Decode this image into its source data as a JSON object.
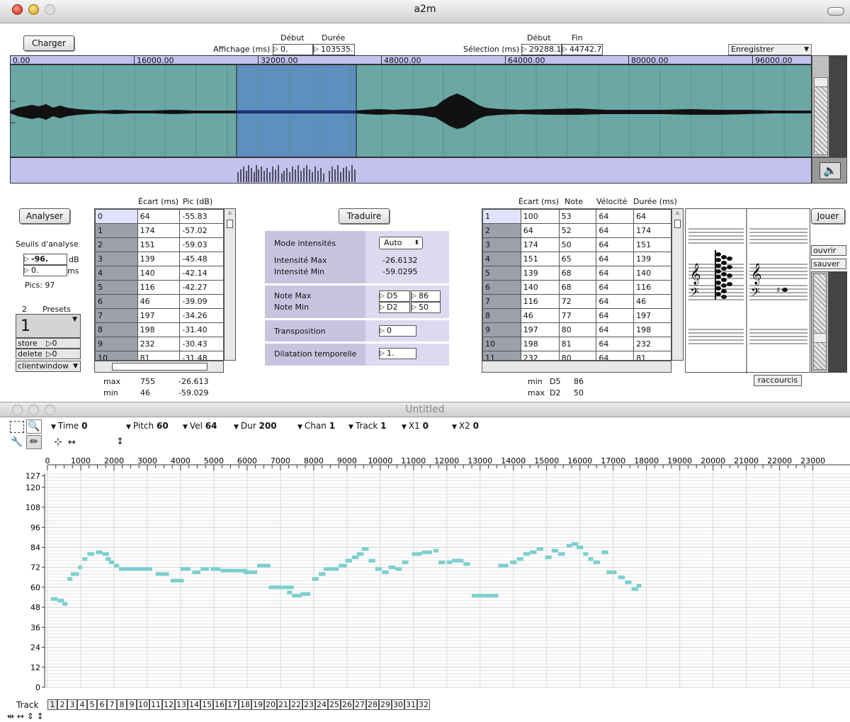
{
  "window_a2m": {
    "title": "a2m",
    "charger": "Charger",
    "affichage_label": "Affichage (ms)",
    "debut_label": "Début",
    "duree_label": "Durée",
    "affichage_debut": "0.",
    "affichage_duree": "103535.",
    "selection_label": "Sélection (ms)",
    "selection_debut_label": "Début",
    "selection_fin_label": "Fin",
    "selection_debut": "29288.1",
    "selection_fin": "44742.7",
    "enregistrer": "Enregistrer",
    "ruler": [
      "0.00",
      "16000.00",
      "32000.00",
      "48000.00",
      "64000.00",
      "80000.00",
      "96000.00"
    ],
    "analyser": "Analyser",
    "seuils_label": "Seuils d'analyse",
    "seuil_db": "-96.",
    "seuil_db_unit": "dB",
    "seuil_ms": "0.",
    "seuil_ms_unit": "ms",
    "pics": "Pics: 97",
    "presets_count": "2",
    "presets_label": "Presets",
    "preset_value": "1",
    "store": "store",
    "store_val": "0",
    "delete": "delete",
    "delete_val": "0",
    "clientwindow": "clientwindow",
    "left_table": {
      "headers": [
        "Écart (ms)",
        "Pic (dB)"
      ],
      "rows": [
        [
          "0",
          "64",
          "-55.83"
        ],
        [
          "1",
          "174",
          "-57.02"
        ],
        [
          "2",
          "151",
          "-59.03"
        ],
        [
          "3",
          "139",
          "-45.48"
        ],
        [
          "4",
          "140",
          "-42.14"
        ],
        [
          "5",
          "116",
          "-42.27"
        ],
        [
          "6",
          "46",
          "-39.09"
        ],
        [
          "7",
          "197",
          "-34.26"
        ],
        [
          "8",
          "198",
          "-31.40"
        ],
        [
          "9",
          "232",
          "-30.43"
        ],
        [
          "10",
          "81",
          "-31.48"
        ]
      ],
      "max_label": "max",
      "min_label": "min",
      "max_ecart": "755",
      "max_pic": "-26.613",
      "min_ecart": "46",
      "min_pic": "-59.029"
    },
    "traduire": "Traduire",
    "mode_intensites_label": "Mode intensités",
    "mode_intensites_value": "Auto",
    "intensite_max_label": "Intensité Max",
    "intensite_min_label": "Intensité Min",
    "intensite_max": "-26.6132",
    "intensite_min": "-59.0295",
    "note_max_label": "Note Max",
    "note_min_label": "Note Min",
    "note_max_name": "D5",
    "note_max_num": "86",
    "note_min_name": "D2",
    "note_min_num": "50",
    "transposition_label": "Transposition",
    "transposition": "0",
    "dilatation_label": "Dilatation temporelle",
    "dilatation": "1.",
    "right_table": {
      "headers": [
        "Écart (ms)",
        "Note",
        "Vélocité",
        "Durée (ms)"
      ],
      "rows": [
        [
          "1",
          "100",
          "53",
          "64",
          "64"
        ],
        [
          "2",
          "64",
          "52",
          "64",
          "174"
        ],
        [
          "3",
          "174",
          "50",
          "64",
          "151"
        ],
        [
          "4",
          "151",
          "65",
          "64",
          "139"
        ],
        [
          "5",
          "139",
          "68",
          "64",
          "140"
        ],
        [
          "6",
          "140",
          "68",
          "64",
          "116"
        ],
        [
          "7",
          "116",
          "72",
          "64",
          "46"
        ],
        [
          "8",
          "46",
          "77",
          "64",
          "197"
        ],
        [
          "9",
          "197",
          "80",
          "64",
          "198"
        ],
        [
          "10",
          "198",
          "81",
          "64",
          "232"
        ],
        [
          "11",
          "232",
          "80",
          "64",
          "81"
        ]
      ],
      "min_label": "min",
      "max_label": "max",
      "min_note": "D5",
      "min_num": "86",
      "max_note": "D2",
      "max_num": "50"
    },
    "jouer": "Jouer",
    "ouvrir": "ouvrir",
    "sauver": "sauver",
    "raccourcis": "raccourcis"
  },
  "window_untitled": {
    "title": "Untitled",
    "controls": [
      {
        "label": "Time",
        "value": "0"
      },
      {
        "label": "Pitch",
        "value": "60"
      },
      {
        "label": "Vel",
        "value": "64"
      },
      {
        "label": "Dur",
        "value": "200"
      },
      {
        "label": "Chan",
        "value": "1"
      },
      {
        "label": "Track",
        "value": "1"
      },
      {
        "label": "X1",
        "value": "0"
      },
      {
        "label": "X2",
        "value": "0"
      }
    ],
    "track_label": "Track",
    "tracks": [
      "1",
      "2",
      "3",
      "4",
      "5",
      "6",
      "7",
      "8",
      "9",
      "10",
      "11",
      "12",
      "13",
      "14",
      "15",
      "16",
      "17",
      "18",
      "19",
      "20",
      "21",
      "22",
      "23",
      "24",
      "25",
      "26",
      "27",
      "28",
      "29",
      "30",
      "31",
      "32"
    ]
  },
  "chart_data": {
    "type": "scatter",
    "title": "",
    "xlabel": "",
    "ylabel": "",
    "xlim": [
      0,
      23200
    ],
    "ylim": [
      0,
      128
    ],
    "x_ticks": [
      "0",
      "1000",
      "2000",
      "3000",
      "4000",
      "5000",
      "6000",
      "7000",
      "8000",
      "9000",
      "10000",
      "11000",
      "12000",
      "13000",
      "14000",
      "15000",
      "16000",
      "17000",
      "18000",
      "19000",
      "20000",
      "21000",
      "22000",
      "23000"
    ],
    "y_ticks": [
      "0",
      "12",
      "24",
      "36",
      "48",
      "60",
      "72",
      "84",
      "96",
      "108",
      "120",
      "127"
    ],
    "note_color": "#7ccfcf",
    "notes": [
      [
        100,
        200,
        53
      ],
      [
        300,
        200,
        52
      ],
      [
        450,
        150,
        50
      ],
      [
        600,
        150,
        65
      ],
      [
        700,
        150,
        68
      ],
      [
        800,
        150,
        68
      ],
      [
        920,
        120,
        72
      ],
      [
        1050,
        150,
        77
      ],
      [
        1200,
        200,
        80
      ],
      [
        1450,
        200,
        81
      ],
      [
        1650,
        200,
        80
      ],
      [
        1750,
        150,
        77
      ],
      [
        1850,
        150,
        75
      ],
      [
        2000,
        150,
        73
      ],
      [
        2150,
        500,
        71
      ],
      [
        2650,
        500,
        71
      ],
      [
        3250,
        400,
        68
      ],
      [
        3700,
        400,
        64
      ],
      [
        4000,
        300,
        71
      ],
      [
        4350,
        250,
        69
      ],
      [
        4600,
        250,
        71
      ],
      [
        4900,
        300,
        71
      ],
      [
        5200,
        400,
        70
      ],
      [
        5600,
        400,
        70
      ],
      [
        5900,
        400,
        69
      ],
      [
        6300,
        400,
        73
      ],
      [
        6650,
        400,
        60
      ],
      [
        7000,
        400,
        60
      ],
      [
        7200,
        150,
        57
      ],
      [
        7350,
        300,
        55
      ],
      [
        7600,
        200,
        56
      ],
      [
        7750,
        150,
        56
      ],
      [
        7950,
        200,
        65
      ],
      [
        8150,
        200,
        68
      ],
      [
        8300,
        250,
        71
      ],
      [
        8550,
        200,
        71
      ],
      [
        8750,
        250,
        73
      ],
      [
        8950,
        200,
        76
      ],
      [
        9150,
        200,
        78
      ],
      [
        9300,
        200,
        80
      ],
      [
        9450,
        200,
        83
      ],
      [
        9650,
        200,
        76
      ],
      [
        9850,
        200,
        71
      ],
      [
        10050,
        200,
        69
      ],
      [
        10250,
        200,
        72
      ],
      [
        10450,
        200,
        71
      ],
      [
        10650,
        200,
        75
      ],
      [
        10950,
        300,
        80
      ],
      [
        11250,
        300,
        81
      ],
      [
        11600,
        150,
        82
      ],
      [
        11750,
        200,
        75
      ],
      [
        12000,
        150,
        75
      ],
      [
        12150,
        200,
        76
      ],
      [
        12300,
        200,
        76
      ],
      [
        12500,
        200,
        74
      ],
      [
        12750,
        800,
        55
      ],
      [
        13550,
        300,
        73
      ],
      [
        13900,
        200,
        75
      ],
      [
        14100,
        200,
        77
      ],
      [
        14300,
        200,
        80
      ],
      [
        14500,
        200,
        81
      ],
      [
        14700,
        200,
        83
      ],
      [
        14950,
        200,
        78
      ],
      [
        15150,
        200,
        82
      ],
      [
        15350,
        200,
        80
      ],
      [
        15600,
        150,
        85
      ],
      [
        15750,
        200,
        86
      ],
      [
        15900,
        200,
        84
      ],
      [
        16100,
        150,
        80
      ],
      [
        16250,
        150,
        77
      ],
      [
        16400,
        200,
        75
      ],
      [
        16650,
        200,
        81
      ],
      [
        16800,
        300,
        69
      ],
      [
        17150,
        200,
        66
      ],
      [
        17350,
        200,
        63
      ],
      [
        17550,
        200,
        59
      ],
      [
        17700,
        150,
        61
      ]
    ]
  }
}
